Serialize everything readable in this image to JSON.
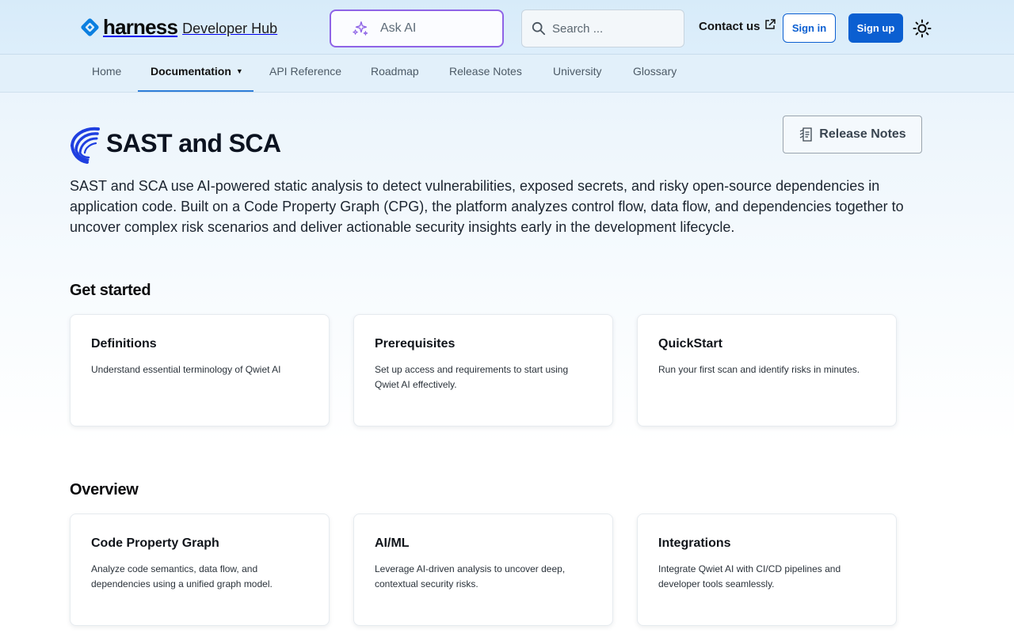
{
  "header": {
    "brand": "harness",
    "subtitle": "Developer Hub",
    "ask_ai": "Ask AI",
    "search_placeholder": "Search ...",
    "contact": "Contact us",
    "sign_in": "Sign in",
    "sign_up": "Sign up",
    "colors": {
      "accent": "#0b5fd1",
      "ask_ai_border": "#8e63e6"
    }
  },
  "nav": {
    "items": [
      "Home",
      "Documentation",
      "API Reference",
      "Roadmap",
      "Release Notes",
      "University",
      "Glossary"
    ],
    "active": "Documentation"
  },
  "page": {
    "title": "SAST and SCA",
    "release_notes_button": "Release Notes",
    "intro": "SAST and SCA use AI-powered static analysis to detect vulnerabilities, exposed secrets, and risky open-source dependencies in application code. Built on a Code Property Graph (CPG), the platform analyzes control flow, data flow, and dependencies together to uncover complex risk scenarios and deliver actionable security insights early in the development lifecycle."
  },
  "sections": [
    {
      "title": "Get started",
      "cards": [
        {
          "title": "Definitions",
          "desc": "Understand essential terminology of Qwiet AI"
        },
        {
          "title": "Prerequisites",
          "desc": "Set up access and requirements to start using Qwiet AI effectively."
        },
        {
          "title": "QuickStart",
          "desc": "Run your first scan and identify risks in minutes."
        }
      ]
    },
    {
      "title": "Overview",
      "cards": [
        {
          "title": "Code Property Graph",
          "desc": "Analyze code semantics, data flow, and dependencies using a unified graph model."
        },
        {
          "title": "AI/ML",
          "desc": "Leverage AI-driven analysis to uncover deep, contextual security risks."
        },
        {
          "title": "Integrations",
          "desc": "Integrate Qwiet AI with CI/CD pipelines and developer tools seamlessly."
        }
      ]
    }
  ]
}
